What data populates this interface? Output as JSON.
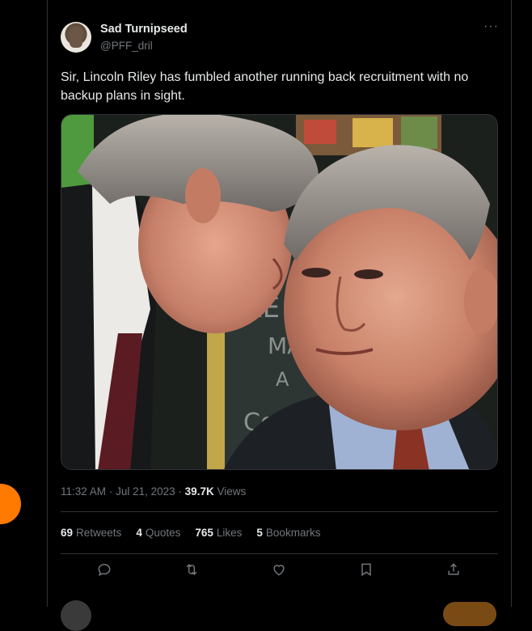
{
  "tweet": {
    "display_name": "Sad Turnipseed",
    "handle": "@PFF_dril",
    "more_label": "···",
    "text": "Sir, Lincoln Riley has fumbled another running back recruitment with no backup plans in sight.",
    "time": "11:32 AM",
    "date": "Jul 21, 2023",
    "separator": "·",
    "views_count": "39.7K",
    "views_label": "Views"
  },
  "stats": [
    {
      "count": "69",
      "label": "Retweets"
    },
    {
      "count": "4",
      "label": "Quotes"
    },
    {
      "count": "765",
      "label": "Likes"
    },
    {
      "count": "5",
      "label": "Bookmarks"
    }
  ],
  "image_text": {
    "line1": "RE",
    "line2": "MA",
    "line3": "A",
    "line4": "Co"
  },
  "colors": {
    "background": "#000000",
    "text": "#e7e9ea",
    "secondary": "#71767b",
    "border": "#2f3336",
    "accent_orange": "#ff7a00"
  },
  "icons": [
    "reply-icon",
    "retweet-icon",
    "like-icon",
    "bookmark-icon",
    "share-icon"
  ]
}
